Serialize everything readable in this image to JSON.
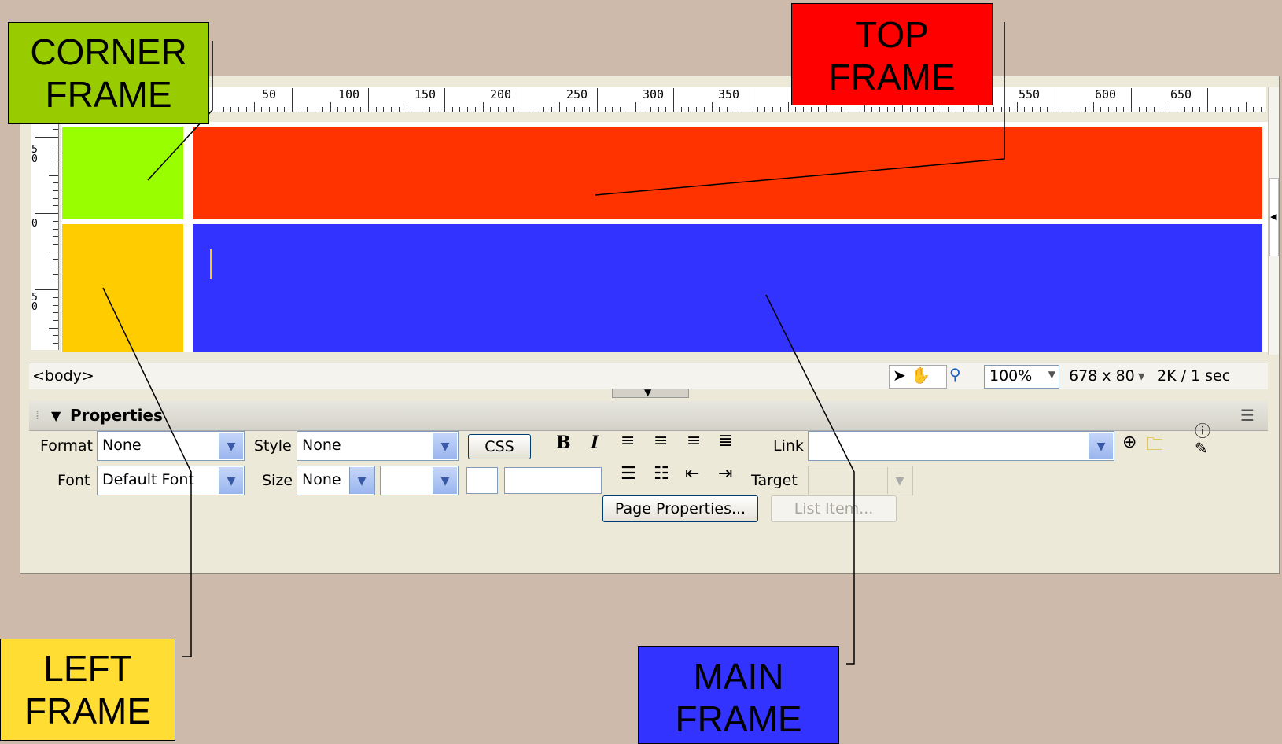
{
  "ruler": {
    "top_marks": [
      "50",
      "100",
      "150",
      "200",
      "250",
      "300",
      "350",
      "",
      "",
      "",
      "",
      "550",
      "600",
      "650"
    ],
    "left_marks": [
      "5 0",
      "0",
      "5 0"
    ]
  },
  "frames": {
    "corner_color": "#99ff00",
    "top_color": "#ff3300",
    "left_color": "#ffcc00",
    "main_color": "#3333ff"
  },
  "statusbar": {
    "tag": "<body>",
    "zoom": "100%",
    "size": "678 x 80",
    "download": "2K / 1 sec"
  },
  "properties": {
    "title": "Properties",
    "format_label": "Format",
    "format_value": "None",
    "style_label": "Style",
    "style_value": "None",
    "css_button": "CSS",
    "link_label": "Link",
    "font_label": "Font",
    "font_value": "Default Font",
    "size_label": "Size",
    "size_value": "None",
    "target_label": "Target",
    "page_properties_button": "Page Properties...",
    "list_item_button": "List Item..."
  },
  "callouts": {
    "corner": "CORNER FRAME",
    "top": "TOP FRAME",
    "left": "LEFT FRAME",
    "main": "MAIN FRAME",
    "corner_color": "#99cc00",
    "top_color": "#ff0000",
    "left_color": "#ffdd33",
    "main_color": "#3333ff"
  }
}
